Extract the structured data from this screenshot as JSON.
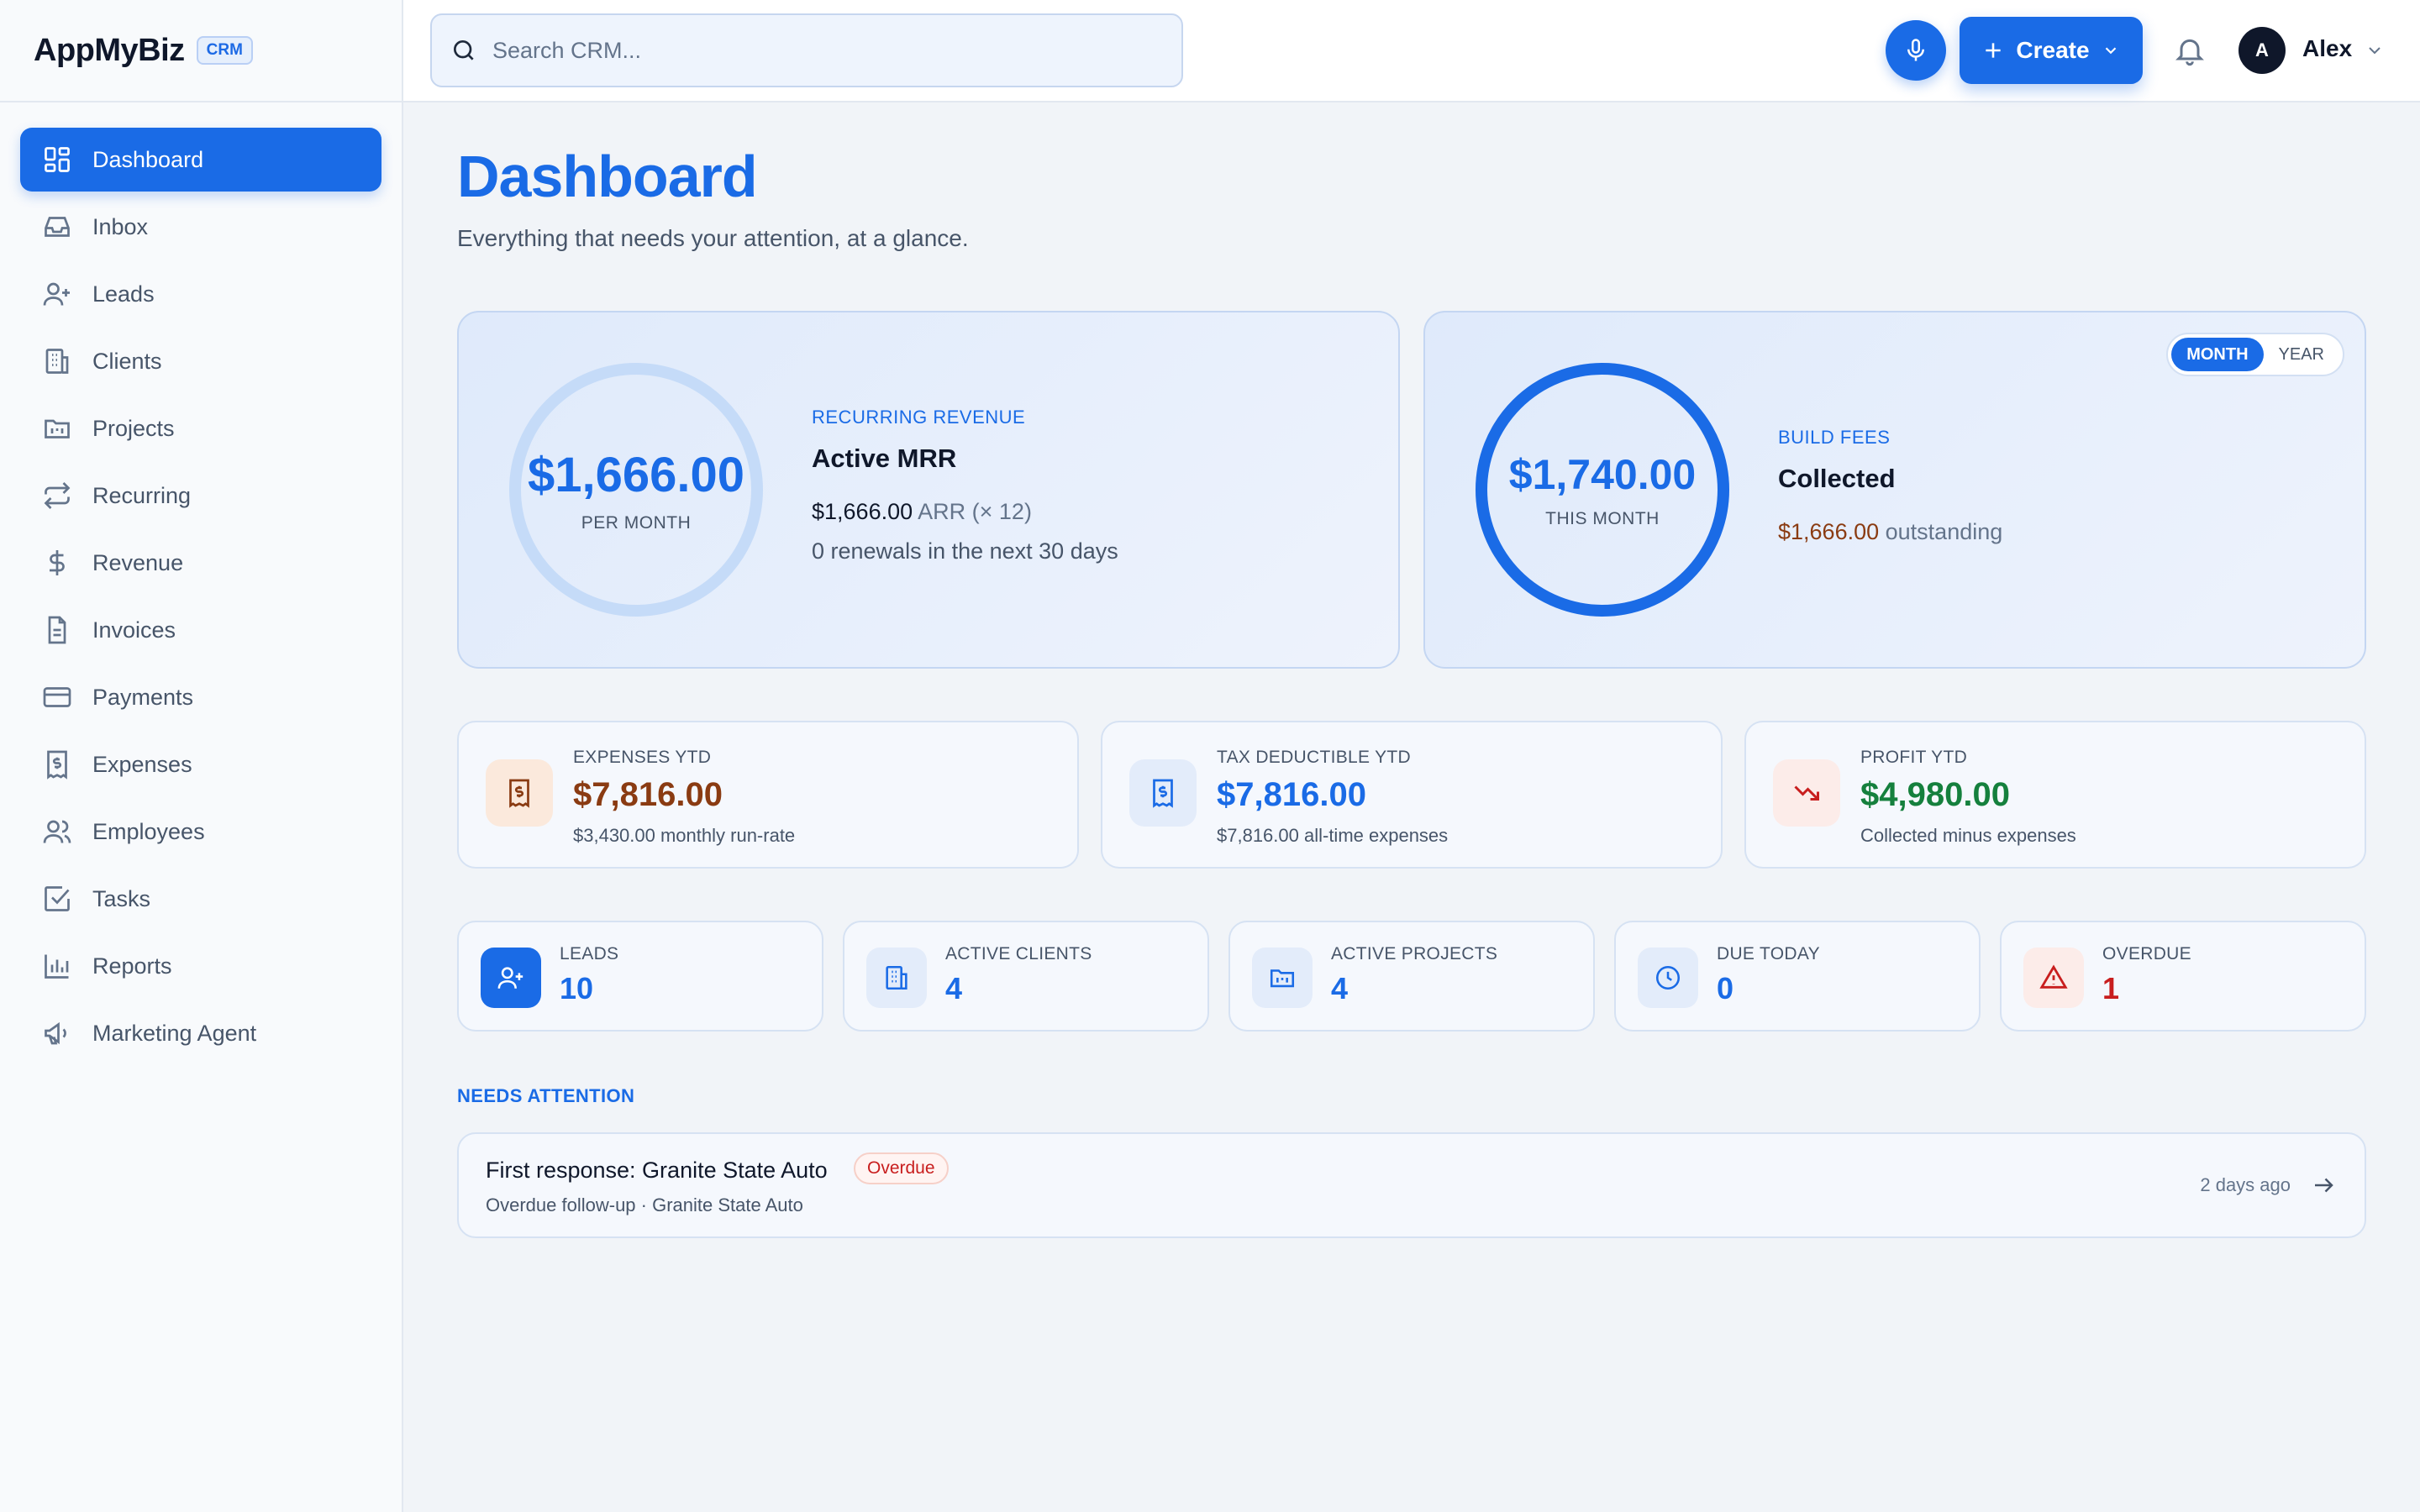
{
  "brand": {
    "name": "AppMyBiz",
    "badge": "CRM"
  },
  "colors": {
    "accent": "#1a6be6",
    "expense": "#8a3b12",
    "profit": "#15803d",
    "danger": "#c81e1e"
  },
  "sidebar": {
    "items": [
      {
        "label": "Dashboard",
        "icon": "dashboard-icon",
        "active": true
      },
      {
        "label": "Inbox",
        "icon": "inbox-icon"
      },
      {
        "label": "Leads",
        "icon": "user-plus-icon"
      },
      {
        "label": "Clients",
        "icon": "building-icon"
      },
      {
        "label": "Projects",
        "icon": "folder-icon"
      },
      {
        "label": "Recurring",
        "icon": "repeat-icon"
      },
      {
        "label": "Revenue",
        "icon": "dollar-icon"
      },
      {
        "label": "Invoices",
        "icon": "file-text-icon"
      },
      {
        "label": "Payments",
        "icon": "credit-card-icon"
      },
      {
        "label": "Expenses",
        "icon": "receipt-icon"
      },
      {
        "label": "Employees",
        "icon": "users-icon"
      },
      {
        "label": "Tasks",
        "icon": "check-square-icon"
      },
      {
        "label": "Reports",
        "icon": "bar-chart-icon"
      },
      {
        "label": "Marketing Agent",
        "icon": "megaphone-icon"
      }
    ]
  },
  "topbar": {
    "search_placeholder": "Search CRM...",
    "create_label": "Create",
    "user_initial": "A",
    "user_name": "Alex"
  },
  "page": {
    "title": "Dashboard",
    "subtitle": "Everything that needs your attention, at a glance."
  },
  "mrr": {
    "amount": "$1,666.00",
    "caption": "PER MONTH",
    "eyebrow": "RECURRING REVENUE",
    "heading": "Active MRR",
    "arr_value": "$1,666.00",
    "arr_label": "ARR (× 12)",
    "renewals": "0 renewals in the next 30 days"
  },
  "build_fees": {
    "amount": "$1,740.00",
    "caption": "THIS MONTH",
    "eyebrow": "BUILD FEES",
    "heading": "Collected",
    "outstanding_value": "$1,666.00",
    "outstanding_label": "outstanding",
    "collected_fraction": 1.0,
    "toggle": {
      "month": "MONTH",
      "year": "YEAR",
      "selected": "MONTH"
    }
  },
  "kpis": [
    {
      "label": "EXPENSES YTD",
      "value": "$7,816.00",
      "note": "$3,430.00 monthly run-rate",
      "icon": "receipt-icon"
    },
    {
      "label": "TAX DEDUCTIBLE YTD",
      "value": "$7,816.00",
      "note": "$7,816.00 all-time expenses",
      "icon": "receipt-icon"
    },
    {
      "label": "PROFIT YTD",
      "value": "$4,980.00",
      "note": "Collected minus expenses",
      "icon": "trending-down-icon"
    }
  ],
  "stats": [
    {
      "label": "LEADS",
      "value": "10",
      "icon": "user-plus-icon"
    },
    {
      "label": "ACTIVE CLIENTS",
      "value": "4",
      "icon": "building-icon"
    },
    {
      "label": "ACTIVE PROJECTS",
      "value": "4",
      "icon": "folder-icon"
    },
    {
      "label": "DUE TODAY",
      "value": "0",
      "icon": "clock-icon"
    },
    {
      "label": "OVERDUE",
      "value": "1",
      "icon": "alert-triangle-icon"
    }
  ],
  "attention": {
    "section_label": "NEEDS ATTENTION",
    "items": [
      {
        "title": "First response: Granite State Auto",
        "badge": "Overdue",
        "subtitle": "Overdue follow-up · Granite State Auto",
        "time": "2 days ago"
      }
    ]
  }
}
